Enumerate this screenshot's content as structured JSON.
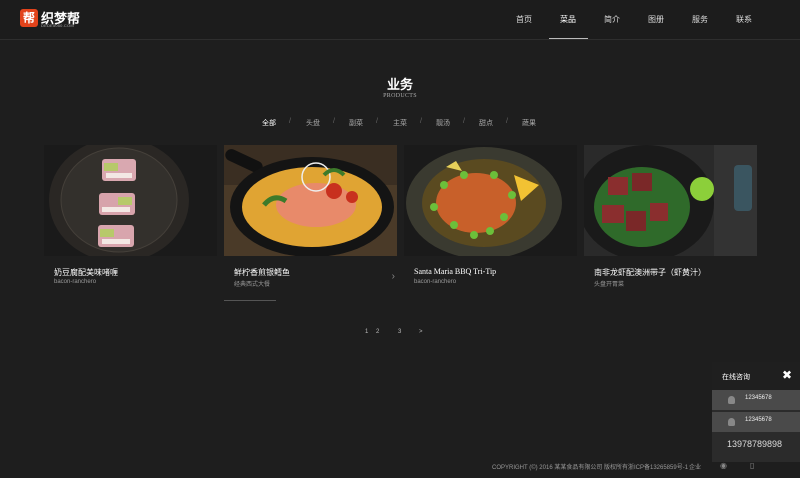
{
  "logo": {
    "mark": "帮",
    "name": "织梦帮",
    "sub": "DEDE5050.COM"
  },
  "nav": {
    "items": [
      {
        "label": "首页"
      },
      {
        "label": "菜品"
      },
      {
        "label": "简介"
      },
      {
        "label": "图册"
      },
      {
        "label": "服务"
      },
      {
        "label": "联系"
      }
    ],
    "active_index": 1
  },
  "section": {
    "title": "业务",
    "subtitle": "PRODUCTS"
  },
  "filters": [
    "全部",
    "头盘",
    "副菜",
    "主菜",
    "靓汤",
    "甜点",
    "蔬果"
  ],
  "cards": [
    {
      "title": "奶豆腐配美味啫喱",
      "subtitle": "bacon-ranchero"
    },
    {
      "title": "鲜柠香煎银鳕鱼",
      "subtitle": "经典西式大餐"
    },
    {
      "title": "Santa Maria BBQ Tri-Tip",
      "subtitle": "bacon-ranchero"
    },
    {
      "title": "南非龙虾配澳洲带子（虾黄汁）",
      "subtitle": "头盘开胃菜"
    }
  ],
  "pagination": [
    "1",
    "2",
    "3",
    ">"
  ],
  "footer": {
    "copyright": "COPYRIGHT (©) 2016 某某食品有限公司 版权所有浙ICP备13265859号-1",
    "extra": "企业"
  },
  "consult": {
    "title": "在线咨询",
    "close": "✖",
    "qq": [
      "12345678",
      "12345678"
    ],
    "phone": "13978789898"
  },
  "colors": {
    "background": "#1e1e1e",
    "header": "#1c1c1c",
    "logo_accent": "#e2431b",
    "panel": "#2b2b2b"
  }
}
